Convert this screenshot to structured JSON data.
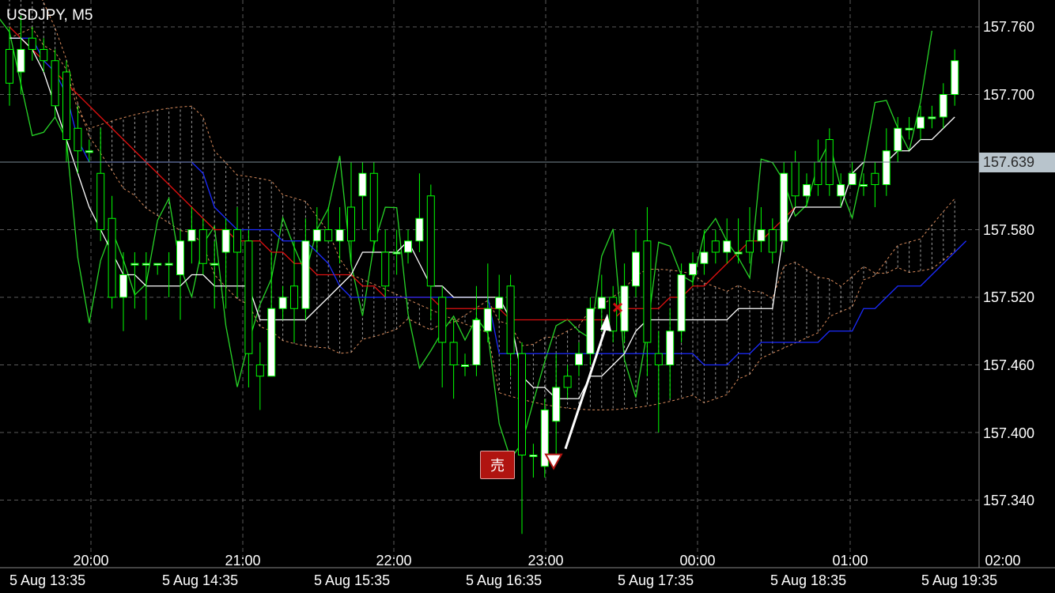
{
  "symbol": "USDJPY, M5",
  "colors": {
    "background": "#000000",
    "grid": "#5a5a5a",
    "bull_body": "#ffffff",
    "bear_body": "#000000",
    "candle_border": "#00ff00",
    "tenkan": "#ffffff",
    "kijun": "#1b2bff",
    "sma": "#e01010",
    "chikou": "#27d427",
    "kumo_edge": "#d98a5a",
    "current_price_bg": "#b8c4cc",
    "sell_badge": "#b01410"
  },
  "price_axis": [
    "157.760",
    "157.700",
    "157.580",
    "157.520",
    "157.460",
    "157.400",
    "157.340"
  ],
  "current_price": "157.639",
  "time_axis_top": [
    "20:00",
    "21:00",
    "22:00",
    "23:00",
    "00:00",
    "01:00",
    "02:00"
  ],
  "time_axis_bottom": [
    "5 Aug 13:35",
    "5 Aug 14:35",
    "5 Aug 15:35",
    "5 Aug 16:35",
    "5 Aug 17:35",
    "5 Aug 18:35",
    "5 Aug 19:35"
  ],
  "trade": {
    "sell_label": "売",
    "entry_price": 157.375,
    "exit_price": 157.511
  },
  "chart_data": {
    "type": "candlestick",
    "ylim": [
      157.31,
      157.78
    ],
    "grid": true,
    "candles": [
      [
        157.74,
        157.71,
        157.76,
        157.69
      ],
      [
        157.72,
        157.74,
        157.77,
        157.7
      ],
      [
        157.75,
        157.74,
        157.76,
        157.73
      ],
      [
        157.74,
        157.73,
        157.75,
        157.72
      ],
      [
        157.73,
        157.69,
        157.74,
        157.68
      ],
      [
        157.72,
        157.66,
        157.73,
        157.64
      ],
      [
        157.67,
        157.65,
        157.69,
        157.63
      ],
      [
        157.65,
        157.65,
        157.66,
        157.64
      ],
      [
        157.63,
        157.58,
        157.67,
        157.57
      ],
      [
        157.59,
        157.52,
        157.61,
        157.51
      ],
      [
        157.52,
        157.54,
        157.56,
        157.49
      ],
      [
        157.55,
        157.55,
        157.56,
        157.51
      ],
      [
        157.55,
        157.55,
        157.56,
        157.5
      ],
      [
        157.55,
        157.55,
        157.55,
        157.54
      ],
      [
        157.55,
        157.55,
        157.56,
        157.52
      ],
      [
        157.54,
        157.57,
        157.58,
        157.5
      ],
      [
        157.57,
        157.58,
        157.6,
        157.55
      ],
      [
        157.58,
        157.55,
        157.59,
        157.54
      ],
      [
        157.55,
        157.55,
        157.57,
        157.51
      ],
      [
        157.56,
        157.58,
        157.59,
        157.51
      ],
      [
        157.58,
        157.56,
        157.6,
        157.52
      ],
      [
        157.57,
        157.47,
        157.58,
        157.44
      ],
      [
        157.46,
        157.45,
        157.48,
        157.42
      ],
      [
        157.45,
        157.51,
        157.56,
        157.45
      ],
      [
        157.51,
        157.52,
        157.53,
        157.5
      ],
      [
        157.53,
        157.51,
        157.57,
        157.48
      ],
      [
        157.51,
        157.57,
        157.59,
        157.5
      ],
      [
        157.57,
        157.58,
        157.6,
        157.56
      ],
      [
        157.58,
        157.57,
        157.6,
        157.57
      ],
      [
        157.57,
        157.58,
        157.6,
        157.55
      ],
      [
        157.6,
        157.57,
        157.64,
        157.55
      ],
      [
        157.61,
        157.63,
        157.64,
        157.58
      ],
      [
        157.63,
        157.57,
        157.64,
        157.56
      ],
      [
        157.56,
        157.53,
        157.58,
        157.52
      ],
      [
        157.56,
        157.56,
        157.58,
        157.54
      ],
      [
        157.56,
        157.57,
        157.58,
        157.55
      ],
      [
        157.57,
        157.59,
        157.63,
        157.56
      ],
      [
        157.61,
        157.53,
        157.62,
        157.5
      ],
      [
        157.52,
        157.48,
        157.53,
        157.44
      ],
      [
        157.48,
        157.46,
        157.5,
        157.43
      ],
      [
        157.46,
        157.46,
        157.47,
        157.45
      ],
      [
        157.46,
        157.5,
        157.53,
        157.45
      ],
      [
        157.49,
        157.51,
        157.55,
        157.48
      ],
      [
        157.51,
        157.52,
        157.54,
        157.5
      ],
      [
        157.53,
        157.47,
        157.54,
        157.45
      ],
      [
        157.47,
        157.38,
        157.48,
        157.31
      ],
      [
        157.38,
        157.38,
        157.39,
        157.36
      ],
      [
        157.37,
        157.42,
        157.43,
        157.36
      ],
      [
        157.41,
        157.44,
        157.47,
        157.38
      ],
      [
        157.45,
        157.44,
        157.46,
        157.43
      ],
      [
        157.46,
        157.47,
        157.48,
        157.45
      ],
      [
        157.47,
        157.51,
        157.52,
        157.46
      ],
      [
        157.51,
        157.52,
        157.54,
        157.49
      ],
      [
        157.52,
        157.49,
        157.53,
        157.48
      ],
      [
        157.49,
        157.53,
        157.55,
        157.48
      ],
      [
        157.53,
        157.56,
        157.58,
        157.52
      ],
      [
        157.57,
        157.48,
        157.6,
        157.45
      ],
      [
        157.47,
        157.46,
        157.49,
        157.4
      ],
      [
        157.46,
        157.49,
        157.51,
        157.43
      ],
      [
        157.49,
        157.54,
        157.55,
        157.48
      ],
      [
        157.54,
        157.55,
        157.56,
        157.53
      ],
      [
        157.55,
        157.56,
        157.58,
        157.54
      ],
      [
        157.57,
        157.56,
        157.58,
        157.55
      ],
      [
        157.56,
        157.57,
        157.59,
        157.55
      ],
      [
        157.56,
        157.56,
        157.59,
        157.55
      ],
      [
        157.57,
        157.56,
        157.6,
        157.55
      ],
      [
        157.57,
        157.58,
        157.6,
        157.56
      ],
      [
        157.58,
        157.56,
        157.59,
        157.55
      ],
      [
        157.57,
        157.63,
        157.64,
        157.56
      ],
      [
        157.64,
        157.61,
        157.65,
        157.6
      ],
      [
        157.61,
        157.62,
        157.63,
        157.6
      ],
      [
        157.64,
        157.62,
        157.66,
        157.61
      ],
      [
        157.66,
        157.62,
        157.67,
        157.61
      ],
      [
        157.61,
        157.62,
        157.63,
        157.6
      ],
      [
        157.62,
        157.63,
        157.64,
        157.62
      ],
      [
        157.62,
        157.62,
        157.63,
        157.61
      ],
      [
        157.63,
        157.62,
        157.64,
        157.6
      ],
      [
        157.62,
        157.65,
        157.67,
        157.61
      ],
      [
        157.65,
        157.67,
        157.68,
        157.64
      ],
      [
        157.67,
        157.67,
        157.68,
        157.66
      ],
      [
        157.67,
        157.68,
        157.69,
        157.66
      ],
      [
        157.68,
        157.68,
        157.69,
        157.67
      ],
      [
        157.68,
        157.7,
        157.71,
        157.67
      ],
      [
        157.7,
        157.73,
        157.74,
        157.69
      ]
    ],
    "tenkan_sen": [
      157.75,
      157.75,
      157.74,
      157.72,
      157.69,
      157.66,
      157.63,
      157.6,
      157.58,
      157.56,
      157.54,
      157.54,
      157.53,
      157.53,
      157.53,
      157.53,
      157.54,
      157.54,
      157.53,
      157.53,
      157.53,
      157.53,
      157.5,
      157.5,
      157.5,
      157.5,
      157.5,
      157.51,
      157.52,
      157.53,
      157.54,
      157.56,
      157.56,
      157.56,
      157.56,
      157.57,
      157.55,
      157.53,
      157.53,
      157.52,
      157.52,
      157.52,
      157.52,
      157.52,
      157.5,
      157.45,
      157.44,
      157.44,
      157.43,
      157.43,
      157.43,
      157.45,
      157.45,
      157.46,
      157.47,
      157.49,
      157.5,
      157.5,
      157.5,
      157.5,
      157.5,
      157.5,
      157.5,
      157.5,
      157.51,
      157.51,
      157.51,
      157.51,
      157.58,
      157.6,
      157.6,
      157.6,
      157.6,
      157.6,
      157.63,
      157.64,
      157.64,
      157.64,
      157.65,
      157.65,
      157.66,
      157.66,
      157.67,
      157.68
    ],
    "kijun_sen": [
      157.75,
      157.75,
      157.75,
      157.73,
      157.72,
      157.7,
      157.66,
      157.64,
      157.64,
      157.64,
      157.64,
      157.64,
      157.64,
      157.64,
      157.64,
      157.64,
      157.64,
      157.63,
      157.6,
      157.59,
      157.58,
      157.58,
      157.58,
      157.58,
      157.57,
      157.57,
      157.57,
      157.56,
      157.55,
      157.53,
      157.52,
      157.52,
      157.52,
      157.52,
      157.52,
      157.52,
      157.52,
      157.52,
      157.52,
      157.52,
      157.52,
      157.52,
      157.52,
      157.47,
      157.47,
      157.47,
      157.47,
      157.47,
      157.47,
      157.47,
      157.47,
      157.47,
      157.47,
      157.47,
      157.47,
      157.47,
      157.47,
      157.47,
      157.47,
      157.47,
      157.47,
      157.46,
      157.46,
      157.46,
      157.47,
      157.47,
      157.48,
      157.48,
      157.48,
      157.48,
      157.48,
      157.48,
      157.49,
      157.49,
      157.49,
      157.51,
      157.51,
      157.52,
      157.53,
      157.53,
      157.53,
      157.54,
      157.55,
      157.56,
      157.57
    ],
    "sma": [
      157.76,
      157.75,
      157.74,
      157.73,
      157.72,
      157.71,
      157.7,
      157.69,
      157.68,
      157.67,
      157.66,
      157.65,
      157.64,
      157.63,
      157.62,
      157.61,
      157.6,
      157.59,
      157.58,
      157.58,
      157.57,
      157.57,
      157.57,
      157.56,
      157.56,
      157.55,
      157.55,
      157.54,
      157.54,
      157.54,
      157.54,
      157.53,
      157.53,
      157.52,
      157.52,
      157.52,
      157.52,
      157.52,
      157.51,
      157.51,
      157.51,
      157.51,
      157.51,
      157.51,
      157.5,
      157.5,
      157.5,
      157.5,
      157.5,
      157.5,
      157.5,
      157.5,
      157.5,
      157.5,
      157.51,
      157.51,
      157.51,
      157.51,
      157.52,
      157.52,
      157.53,
      157.53,
      157.54,
      157.55,
      157.56,
      157.57,
      157.57,
      157.58,
      157.59,
      157.6
    ]
  }
}
